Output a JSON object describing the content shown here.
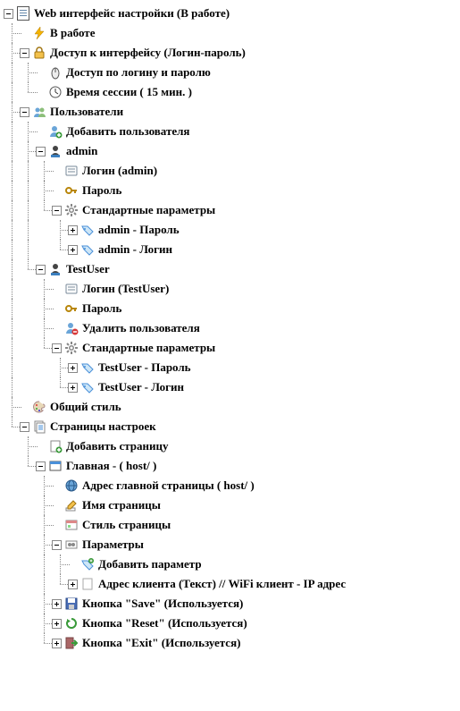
{
  "tree": [
    {
      "id": "root",
      "depth": 0,
      "toggle": "minus",
      "icon": "page",
      "label": "Web интерфейс настройки (В работе)"
    },
    {
      "id": "status",
      "depth": 1,
      "toggle": "leaf",
      "icon": "bolt",
      "label": "В работе"
    },
    {
      "id": "access",
      "depth": 1,
      "toggle": "minus",
      "icon": "lock",
      "label": "Доступ к интерфейсу (Логин-пароль)"
    },
    {
      "id": "access-login",
      "depth": 2,
      "toggle": "leaf",
      "icon": "mouse",
      "label": "Доступ по логину и паролю"
    },
    {
      "id": "session",
      "depth": 2,
      "toggle": "leaf",
      "icon": "clock",
      "label": "Время сессии ( 15 мин. )"
    },
    {
      "id": "users",
      "depth": 1,
      "toggle": "minus",
      "icon": "users",
      "label": "Пользователи"
    },
    {
      "id": "add-user",
      "depth": 2,
      "toggle": "leaf",
      "icon": "user-add",
      "label": "Добавить пользователя"
    },
    {
      "id": "admin",
      "depth": 2,
      "toggle": "minus",
      "icon": "user",
      "label": "admin"
    },
    {
      "id": "admin-login",
      "depth": 3,
      "toggle": "leaf",
      "icon": "form",
      "label": "Логин (admin)"
    },
    {
      "id": "admin-pass",
      "depth": 3,
      "toggle": "leaf",
      "icon": "key",
      "label": "Пароль"
    },
    {
      "id": "admin-std",
      "depth": 3,
      "toggle": "minus",
      "icon": "gear",
      "label": "Стандартные параметры"
    },
    {
      "id": "admin-std-pass",
      "depth": 4,
      "toggle": "plus",
      "icon": "tag",
      "label": "admin - Пароль"
    },
    {
      "id": "admin-std-login",
      "depth": 4,
      "toggle": "plus",
      "icon": "tag",
      "label": "admin - Логин"
    },
    {
      "id": "testuser",
      "depth": 2,
      "toggle": "minus",
      "icon": "user",
      "label": "TestUser"
    },
    {
      "id": "testuser-login",
      "depth": 3,
      "toggle": "leaf",
      "icon": "form",
      "label": "Логин (TestUser)"
    },
    {
      "id": "testuser-pass",
      "depth": 3,
      "toggle": "leaf",
      "icon": "key",
      "label": "Пароль"
    },
    {
      "id": "testuser-del",
      "depth": 3,
      "toggle": "leaf",
      "icon": "user-del",
      "label": "Удалить пользователя"
    },
    {
      "id": "testuser-std",
      "depth": 3,
      "toggle": "minus",
      "icon": "gear",
      "label": "Стандартные параметры"
    },
    {
      "id": "testuser-std-pass",
      "depth": 4,
      "toggle": "plus",
      "icon": "tag",
      "label": "TestUser - Пароль"
    },
    {
      "id": "testuser-std-login",
      "depth": 4,
      "toggle": "plus",
      "icon": "tag",
      "label": "TestUser - Логин"
    },
    {
      "id": "style",
      "depth": 1,
      "toggle": "leaf",
      "icon": "palette",
      "label": "Общий стиль"
    },
    {
      "id": "pages",
      "depth": 1,
      "toggle": "minus",
      "icon": "pages",
      "label": "Страницы настроек"
    },
    {
      "id": "add-page",
      "depth": 2,
      "toggle": "leaf",
      "icon": "page-add",
      "label": "Добавить страницу"
    },
    {
      "id": "main-page",
      "depth": 2,
      "toggle": "minus",
      "icon": "window",
      "label": "Главная -  ( host/ )"
    },
    {
      "id": "main-addr",
      "depth": 3,
      "toggle": "leaf",
      "icon": "globe",
      "label": "Адрес главной страницы ( host/ )"
    },
    {
      "id": "main-name",
      "depth": 3,
      "toggle": "leaf",
      "icon": "pencil",
      "label": "Имя страницы"
    },
    {
      "id": "main-style",
      "depth": 3,
      "toggle": "leaf",
      "icon": "style",
      "label": "Стиль страницы"
    },
    {
      "id": "main-params",
      "depth": 3,
      "toggle": "minus",
      "icon": "params",
      "label": "Параметры"
    },
    {
      "id": "add-param",
      "depth": 4,
      "toggle": "leaf",
      "icon": "tag-add",
      "label": "Добавить параметр"
    },
    {
      "id": "client-addr",
      "depth": 4,
      "toggle": "plus",
      "icon": "blank",
      "label": "Адрес клиента (Текст) // WiFi клиент - IP адрес"
    },
    {
      "id": "btn-save",
      "depth": 3,
      "toggle": "plus",
      "icon": "save",
      "label": "Кнопка \"Save\" (Используется)"
    },
    {
      "id": "btn-reset",
      "depth": 3,
      "toggle": "plus",
      "icon": "reset",
      "label": "Кнопка \"Reset\" (Используется)"
    },
    {
      "id": "btn-exit",
      "depth": 3,
      "toggle": "plus",
      "icon": "exit",
      "label": "Кнопка \"Exit\" (Используется)"
    }
  ],
  "last_at_depth": {
    "root": false,
    "status": false,
    "access": false,
    "access-login": false,
    "session": true,
    "users": false,
    "add-user": false,
    "admin": false,
    "admin-login": false,
    "admin-pass": false,
    "admin-std": true,
    "admin-std-pass": false,
    "admin-std-login": true,
    "testuser": true,
    "testuser-login": false,
    "testuser-pass": false,
    "testuser-del": false,
    "testuser-std": true,
    "testuser-std-pass": false,
    "testuser-std-login": true,
    "style": false,
    "pages": true,
    "add-page": false,
    "main-page": true,
    "main-addr": false,
    "main-name": false,
    "main-style": false,
    "main-params": false,
    "add-param": false,
    "client-addr": true,
    "btn-save": false,
    "btn-reset": false,
    "btn-exit": true
  }
}
